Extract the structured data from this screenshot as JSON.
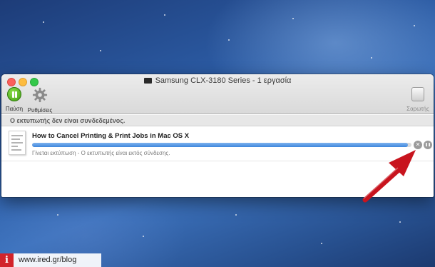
{
  "window": {
    "title": "Samsung CLX-3180 Series - 1 εργασία"
  },
  "toolbar": {
    "pause_label": "Παύση",
    "settings_label": "Ρυθμίσεις",
    "supplies_label": "Σαρωτής"
  },
  "status": {
    "message": "Ο εκτυπωτής δεν είναι συνδεδεμένος."
  },
  "job": {
    "name": "How to Cancel Printing & Print Jobs in Mac OS X",
    "status": "Γίνεται εκτύπωση - Ο εκτυπωτής είναι εκτός σύνδεσης.",
    "progress": 0.99,
    "delete_symbol": "✕",
    "hold_symbol": "❚❚"
  },
  "watermark": {
    "logo": "i",
    "text": "www.ired.gr/blog"
  },
  "colors": {
    "progress": "#3d86dc",
    "arrow": "#c8141e",
    "pause_button": "#4ca81a"
  },
  "icons": {
    "pause": "pause-icon",
    "settings": "gear-icon",
    "supplies": "supply-icon",
    "delete": "close-icon",
    "hold": "pause-icon",
    "arrow": "arrow-icon"
  }
}
